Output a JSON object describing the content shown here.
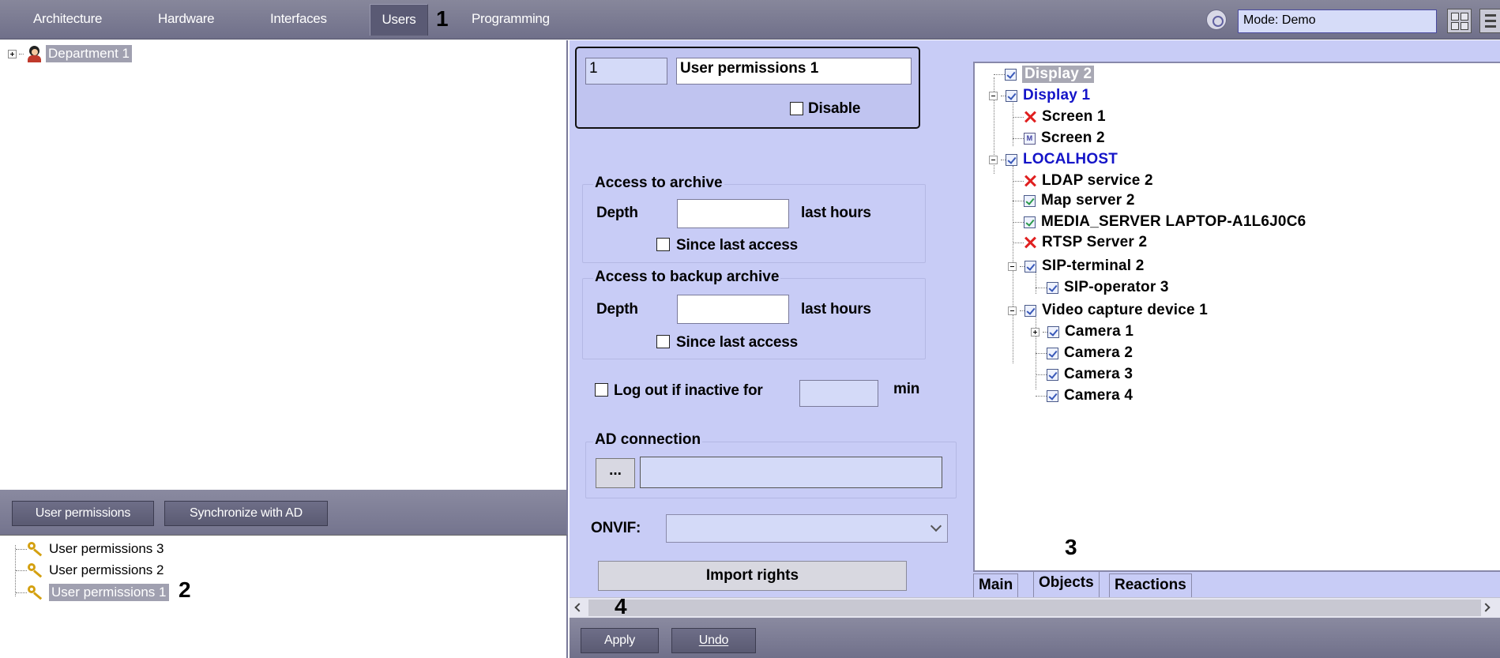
{
  "topbar": {
    "tabs": [
      {
        "label": "Architecture",
        "active": false
      },
      {
        "label": "Hardware",
        "active": false
      },
      {
        "label": "Interfaces",
        "active": false
      },
      {
        "label": "Users",
        "active": true
      },
      {
        "label": "Programming",
        "active": false
      }
    ],
    "mode_value": "Mode: Demo",
    "callout": "1"
  },
  "departments": {
    "items": [
      {
        "label": "Department 1"
      }
    ]
  },
  "permissions_bar": {
    "user_permissions_label": "User permissions",
    "synchronize_label": "Synchronize with AD"
  },
  "permissions_list": {
    "items": [
      {
        "label": "User permissions 3"
      },
      {
        "label": "User permissions 2"
      },
      {
        "label": "User permissions 1",
        "selected": true
      }
    ],
    "callout": "2"
  },
  "form": {
    "id_value": "1",
    "name_value": "User permissions 1",
    "disable_label": "Disable",
    "archive": {
      "title": "Access to archive",
      "depth_label": "Depth",
      "depth_value": "",
      "hours_label": "last hours",
      "since_label": "Since last access"
    },
    "backup": {
      "title": "Access to backup archive",
      "depth_label": "Depth",
      "depth_value": "",
      "hours_label": "last hours",
      "since_label": "Since last access"
    },
    "logout_label": "Log out if inactive for",
    "logout_value": "",
    "logout_unit": "min",
    "ad_title": "AD connection",
    "ad_browse": "...",
    "ad_value": "",
    "onvif_label": "ONVIF:",
    "onvif_value": "",
    "import_label": "Import rights",
    "callout": "4"
  },
  "objects": {
    "items": [
      {
        "label": "Display 2"
      },
      {
        "label": "Display 1"
      },
      {
        "label": "Screen 1"
      },
      {
        "label": "Screen 2"
      },
      {
        "label": "LOCALHOST"
      },
      {
        "label": "LDAP service 2"
      },
      {
        "label": "Map server 2"
      },
      {
        "label": "MEDIA_SERVER LAPTOP-A1L6J0C6"
      },
      {
        "label": "RTSP Server 2"
      },
      {
        "label": "SIP-terminal 2"
      },
      {
        "label": "SIP-operator 3"
      },
      {
        "label": "Video capture device 1"
      },
      {
        "label": "Camera 1"
      },
      {
        "label": "Camera 2"
      },
      {
        "label": "Camera 3"
      },
      {
        "label": "Camera 4"
      }
    ],
    "m_badge": "M",
    "tabs": [
      {
        "label": "Main"
      },
      {
        "label": "Objects"
      },
      {
        "label": "Reactions"
      }
    ],
    "callout": "3"
  },
  "bottom": {
    "apply_label": "Apply",
    "undo_label": "Undo"
  },
  "colors": {
    "toolbar": "#7a7a92",
    "form_bg": "#c8ccf6",
    "link_blue": "#1414c8",
    "deny_red": "#e02020"
  }
}
